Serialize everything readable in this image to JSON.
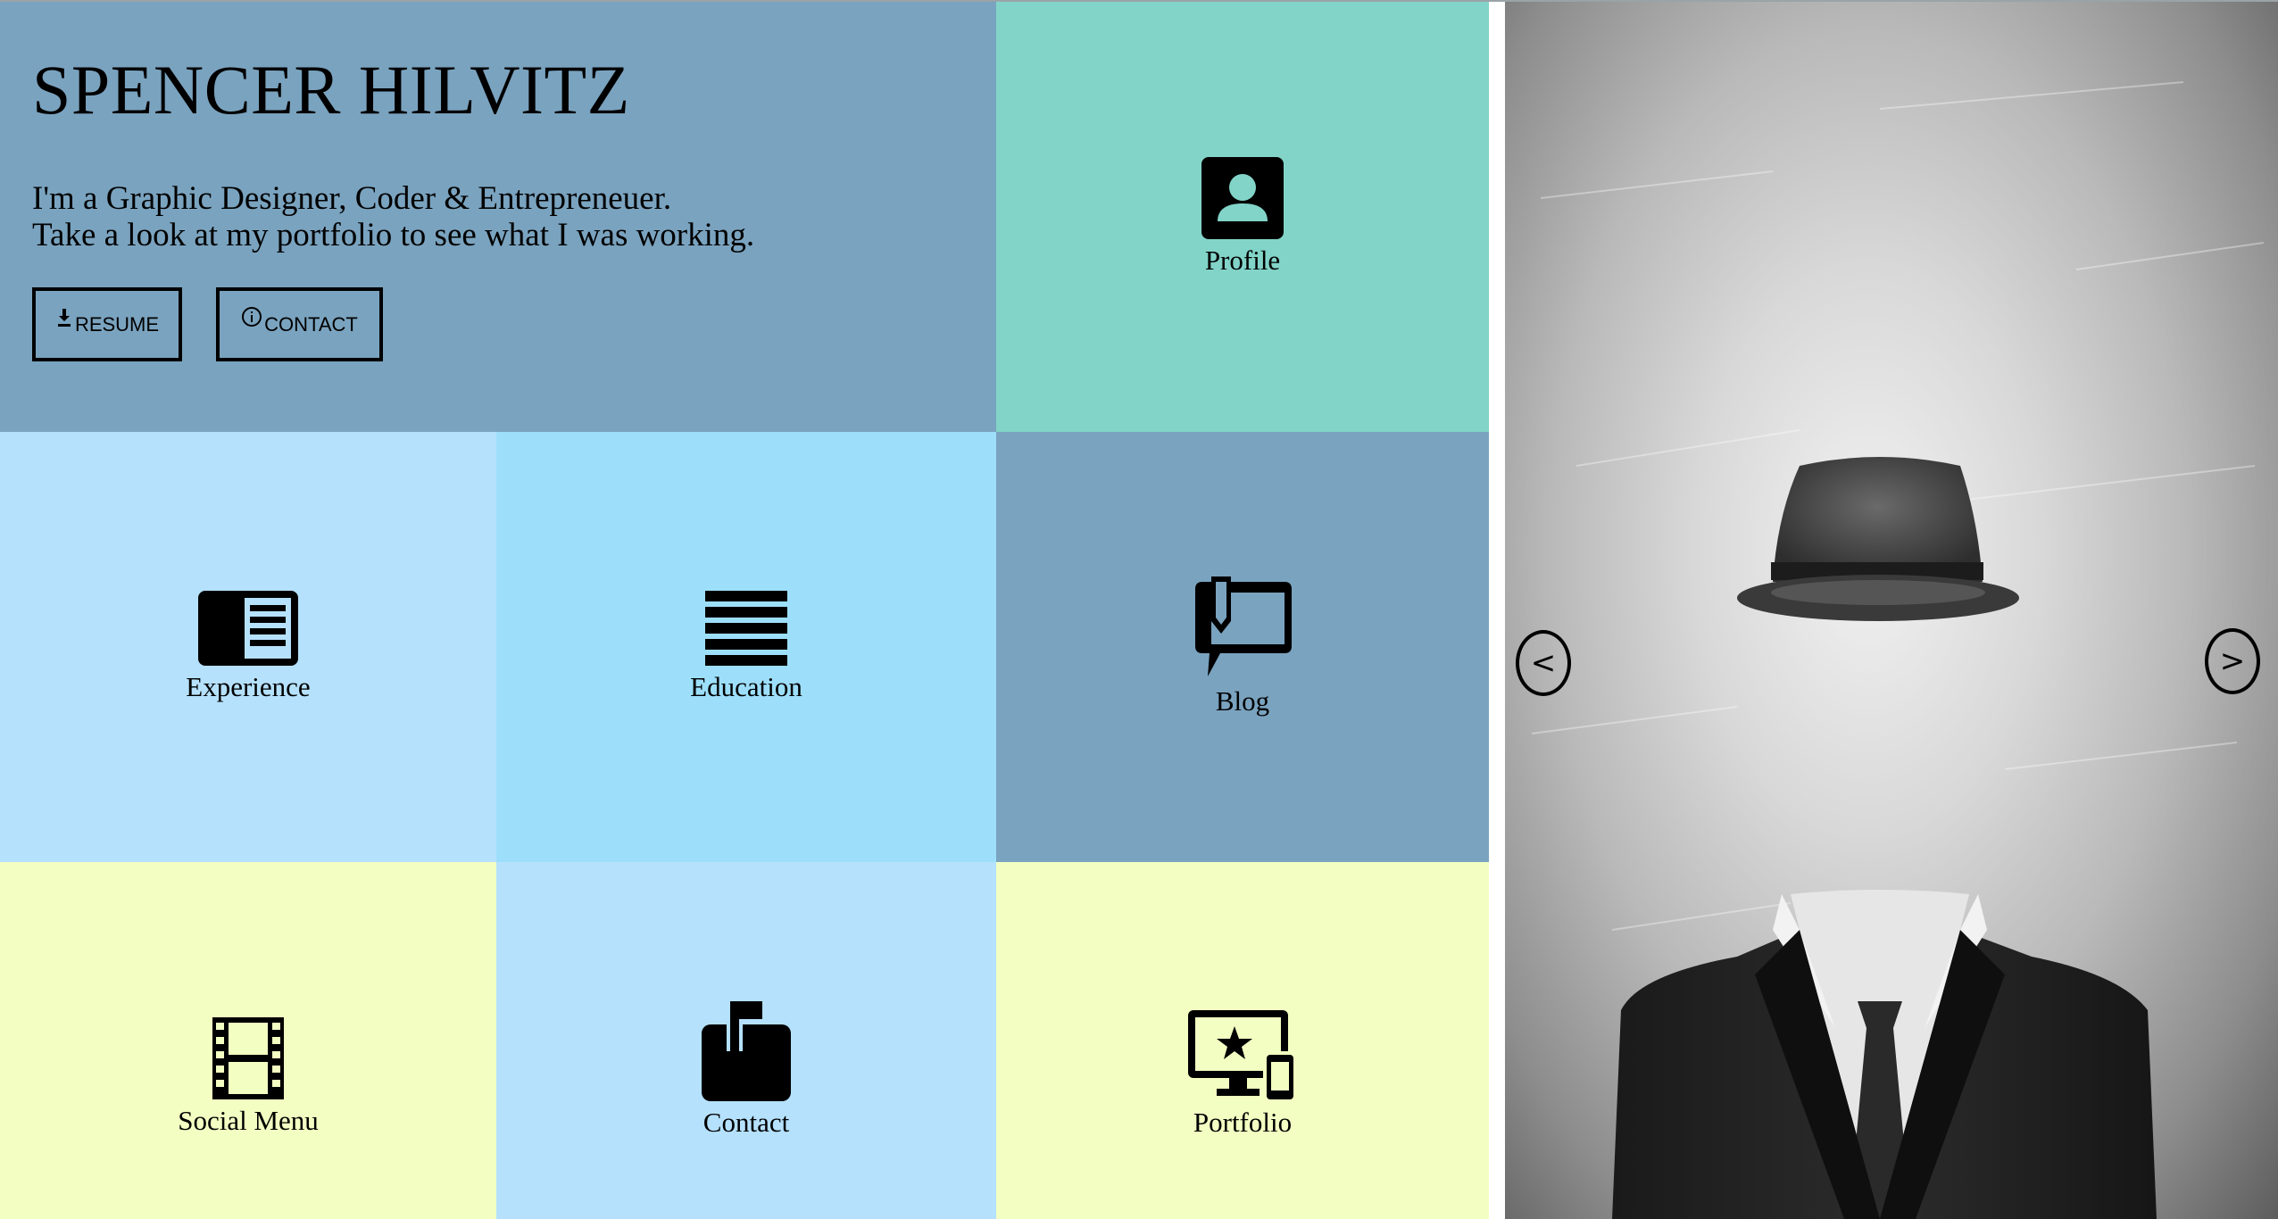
{
  "hero": {
    "name": "SPENCER HILVITZ",
    "tagline_line1": "I'm a Graphic Designer, Coder & Entrepreneuer.",
    "tagline_line2": "Take a look at my portfolio to see what I was working.",
    "resume_label": "RESUME",
    "contact_label": "CONTACT",
    "resume_icon": "download-icon",
    "contact_icon": "info-icon"
  },
  "tiles": {
    "profile": {
      "label": "Profile",
      "icon": "profile-icon",
      "color": "#82d4c8"
    },
    "experience": {
      "label": "Experience",
      "icon": "experience-icon",
      "color": "#b5e1fd"
    },
    "education": {
      "label": "Education",
      "icon": "education-icon",
      "color": "#9ddffb"
    },
    "blog": {
      "label": "Blog",
      "icon": "blog-icon",
      "color": "#7aa3bf"
    },
    "social": {
      "label": "Social Menu",
      "icon": "film-icon",
      "color": "#f3ffc2"
    },
    "contact": {
      "label": "Contact",
      "icon": "mailbox-icon",
      "color": "#b5e1fd"
    },
    "portfolio": {
      "label": "Portfolio",
      "icon": "devices-icon",
      "color": "#f3ffc2"
    }
  },
  "hero_color": "#7aa3bf",
  "slider": {
    "prev_label": "<",
    "next_label": ">",
    "prev_icon": "chevron-left-icon",
    "next_icon": "chevron-right-icon"
  }
}
